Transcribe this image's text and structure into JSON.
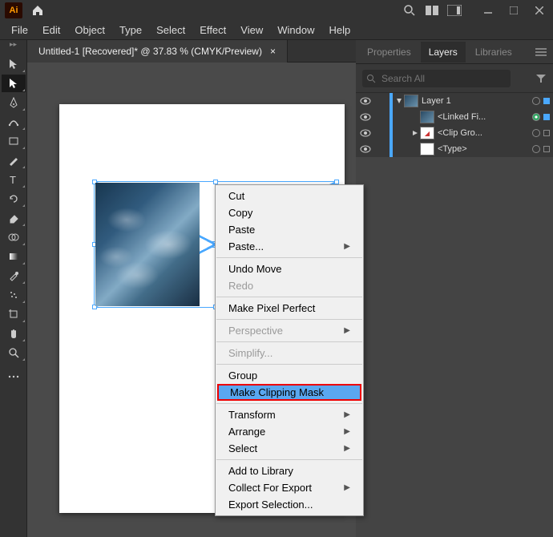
{
  "app": {
    "logo_text": "Ai"
  },
  "menus": [
    "File",
    "Edit",
    "Object",
    "Type",
    "Select",
    "Effect",
    "View",
    "Window",
    "Help"
  ],
  "doc_tab": {
    "title": "Untitled-1 [Recovered]* @ 37.83 % (CMYK/Preview)",
    "close": "×"
  },
  "panel_tabs": {
    "properties": "Properties",
    "layers": "Layers",
    "libraries": "Libraries"
  },
  "search": {
    "placeholder": "Search All"
  },
  "layers": {
    "l1": "Layer 1",
    "linked": "<Linked Fi...",
    "clip": "<Clip Gro...",
    "type": "<Type>"
  },
  "ctx": {
    "cut": "Cut",
    "copy": "Copy",
    "paste": "Paste",
    "paste_sub": "Paste...",
    "undo": "Undo Move",
    "redo": "Redo",
    "pixel": "Make Pixel Perfect",
    "perspective": "Perspective",
    "simplify": "Simplify...",
    "group": "Group",
    "clipmask": "Make Clipping Mask",
    "transform": "Transform",
    "arrange": "Arrange",
    "select": "Select",
    "library": "Add to Library",
    "collect": "Collect For Export",
    "export": "Export Selection..."
  }
}
